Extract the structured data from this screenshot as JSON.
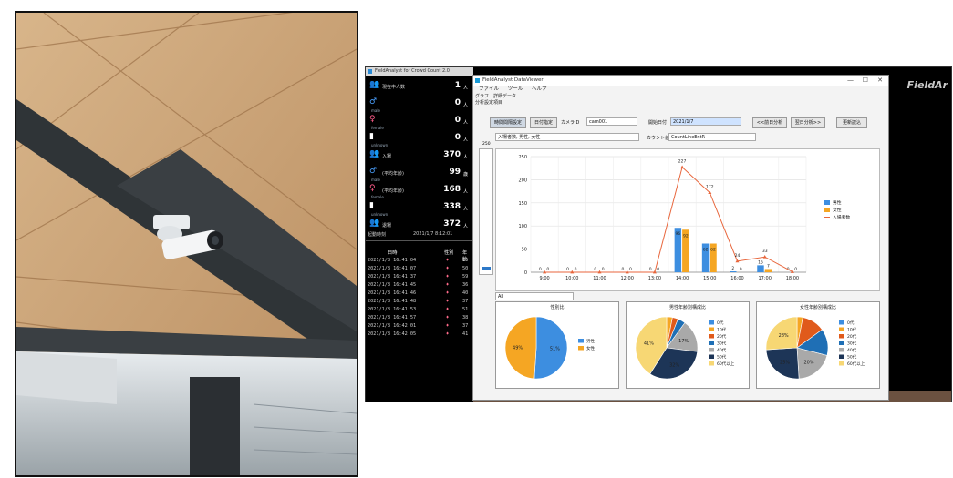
{
  "counter_app": {
    "title": "FieldAnalyst for Crowd Count 2.0",
    "rows": [
      {
        "icon": "group-icon",
        "label": "現在中人数",
        "sub": "",
        "value": "1",
        "unit": "人"
      },
      {
        "icon": "male-icon",
        "label": "",
        "sub": "male",
        "value": "0",
        "unit": "人"
      },
      {
        "icon": "female-icon",
        "label": "",
        "sub": "female",
        "value": "0",
        "unit": "人"
      },
      {
        "icon": "unknown-icon",
        "label": "",
        "sub": "unknown",
        "value": "0",
        "unit": "人"
      },
      {
        "icon": "group-icon",
        "label": "入場",
        "sub": "",
        "value": "370",
        "unit": "人"
      },
      {
        "icon": "male-icon",
        "label": "(平均年齢)",
        "sub": "male",
        "value": "99",
        "unit": "歳"
      },
      {
        "icon": "female-icon",
        "label": "(平均年齢)",
        "sub": "female",
        "value": "168",
        "unit": "人"
      },
      {
        "icon": "unknown-icon",
        "label": "",
        "sub": "unknown",
        "value": "338",
        "unit": "人"
      },
      {
        "icon": "group-icon",
        "label": "退場",
        "sub": "",
        "value": "372",
        "unit": "人"
      }
    ],
    "footer_label": "起動時刻",
    "footer_value": "2021/1/7 8:12:01",
    "log_headers": [
      "日時",
      "性別",
      "年齢"
    ],
    "log_rows": [
      {
        "time": "2021/1/8 16:41:04",
        "age": "15"
      },
      {
        "time": "2021/1/8 16:41:07",
        "age": "50"
      },
      {
        "time": "2021/1/8 16:41:37",
        "age": "59"
      },
      {
        "time": "2021/1/8 16:41:45",
        "age": "36"
      },
      {
        "time": "2021/1/8 16:41:46",
        "age": "40"
      },
      {
        "time": "2021/1/8 16:41:48",
        "age": "37"
      },
      {
        "time": "2021/1/8 16:41:53",
        "age": "51"
      },
      {
        "time": "2021/1/8 16:41:57",
        "age": "38"
      },
      {
        "time": "2021/1/8 16:42:01",
        "age": "37"
      },
      {
        "time": "2021/1/8 16:42:05",
        "age": "41"
      }
    ],
    "brand": "FieldAr"
  },
  "window": {
    "title": "FieldAnalyst DataViewer",
    "menu": [
      "ファイル",
      "ツール",
      "ヘルプ"
    ],
    "tab": "グラフ　詳細データ",
    "group": "分析設定項目",
    "buttons": {
      "period": "時間間隔設定",
      "date": "日付指定",
      "prev": "<<前日分析",
      "next": "翌日分析>>",
      "refresh": "更新読込"
    },
    "camera_label": "カメラID",
    "camera_value": "cam001",
    "date_label": "開始日付",
    "date_value": "2021/1/7",
    "series_select": "入場者数, 男性, 女性",
    "count_label": "カウント値",
    "count_select": "CountLineEntR",
    "scroll_top": "250",
    "pie_select": "All",
    "controls": [
      "—",
      "☐",
      "✕"
    ]
  },
  "chart_data": {
    "type": "bar",
    "categories": [
      "9:00",
      "10:00",
      "11:00",
      "12:00",
      "13:00",
      "14:00",
      "15:00",
      "16:00",
      "17:00",
      "18:00"
    ],
    "ylim": [
      0,
      250
    ],
    "yticks": [
      0,
      50,
      100,
      150,
      200,
      250
    ],
    "series": [
      {
        "name": "男性",
        "type": "bar",
        "color": "#3d8ee0",
        "values": [
          0,
          0,
          0,
          0,
          0,
          96,
          62,
          2,
          15,
          0
        ]
      },
      {
        "name": "女性",
        "type": "bar",
        "color": "#f5a623",
        "values": [
          0,
          0,
          0,
          0,
          0,
          92,
          62,
          0,
          7,
          0
        ]
      },
      {
        "name": "入場者数",
        "type": "line",
        "color": "#e8663c",
        "values": [
          0,
          0,
          0,
          0,
          0,
          227,
          172,
          24,
          33,
          1
        ]
      }
    ],
    "bar_labels": [
      [
        "0",
        "0",
        "0",
        "0",
        "0",
        "96",
        "62",
        "2",
        "15",
        "0"
      ],
      [
        "0",
        "0",
        "0",
        "0",
        "0",
        "92",
        "62",
        "0",
        "7",
        "0"
      ]
    ],
    "line_labels": [
      "0",
      "0",
      "0",
      "0",
      "0",
      "227",
      "172",
      "24",
      "33",
      "1"
    ]
  },
  "pies": [
    {
      "title": "性別比",
      "slices": [
        {
          "label": "男性",
          "value": 51,
          "color": "#3d8ee0",
          "text": "51%"
        },
        {
          "label": "女性",
          "value": 49,
          "color": "#f5a623",
          "text": "49%"
        }
      ]
    },
    {
      "title": "男性年齢別構成比",
      "slices": [
        {
          "label": "10代",
          "value": 3,
          "color": "#f5a623",
          "text": ""
        },
        {
          "label": "20代",
          "value": 3,
          "color": "#e05a1b",
          "text": ""
        },
        {
          "label": "30代",
          "value": 4,
          "color": "#1f6fb5",
          "text": ""
        },
        {
          "label": "40代",
          "value": 17,
          "color": "#a9a9a9",
          "text": "17%"
        },
        {
          "label": "50代",
          "value": 32,
          "color": "#1d3557",
          "text": "32%"
        },
        {
          "label": "60代以上",
          "value": 41,
          "color": "#f7d774",
          "text": "41%"
        }
      ]
    },
    {
      "title": "女性年齢別構成比",
      "slices": [
        {
          "label": "10代",
          "value": 3,
          "color": "#f5a623",
          "text": ""
        },
        {
          "label": "20代",
          "value": 12,
          "color": "#e05a1b",
          "text": ""
        },
        {
          "label": "30代",
          "value": 14,
          "color": "#1f6fb5",
          "text": ""
        },
        {
          "label": "40代",
          "value": 20,
          "color": "#a9a9a9",
          "text": "20%"
        },
        {
          "label": "50代",
          "value": 25,
          "color": "#1d3557",
          "text": "25%"
        },
        {
          "label": "60代以上",
          "value": 26,
          "color": "#f7d774",
          "text": "28%"
        }
      ]
    }
  ],
  "pie_legend": [
    "0代",
    "10代",
    "20代",
    "30代",
    "40代",
    "50代",
    "60代以上"
  ],
  "pie_legend_colors": [
    "#3d8ee0",
    "#f5a623",
    "#e05a1b",
    "#1f6fb5",
    "#a9a9a9",
    "#1d3557",
    "#f7d774"
  ]
}
